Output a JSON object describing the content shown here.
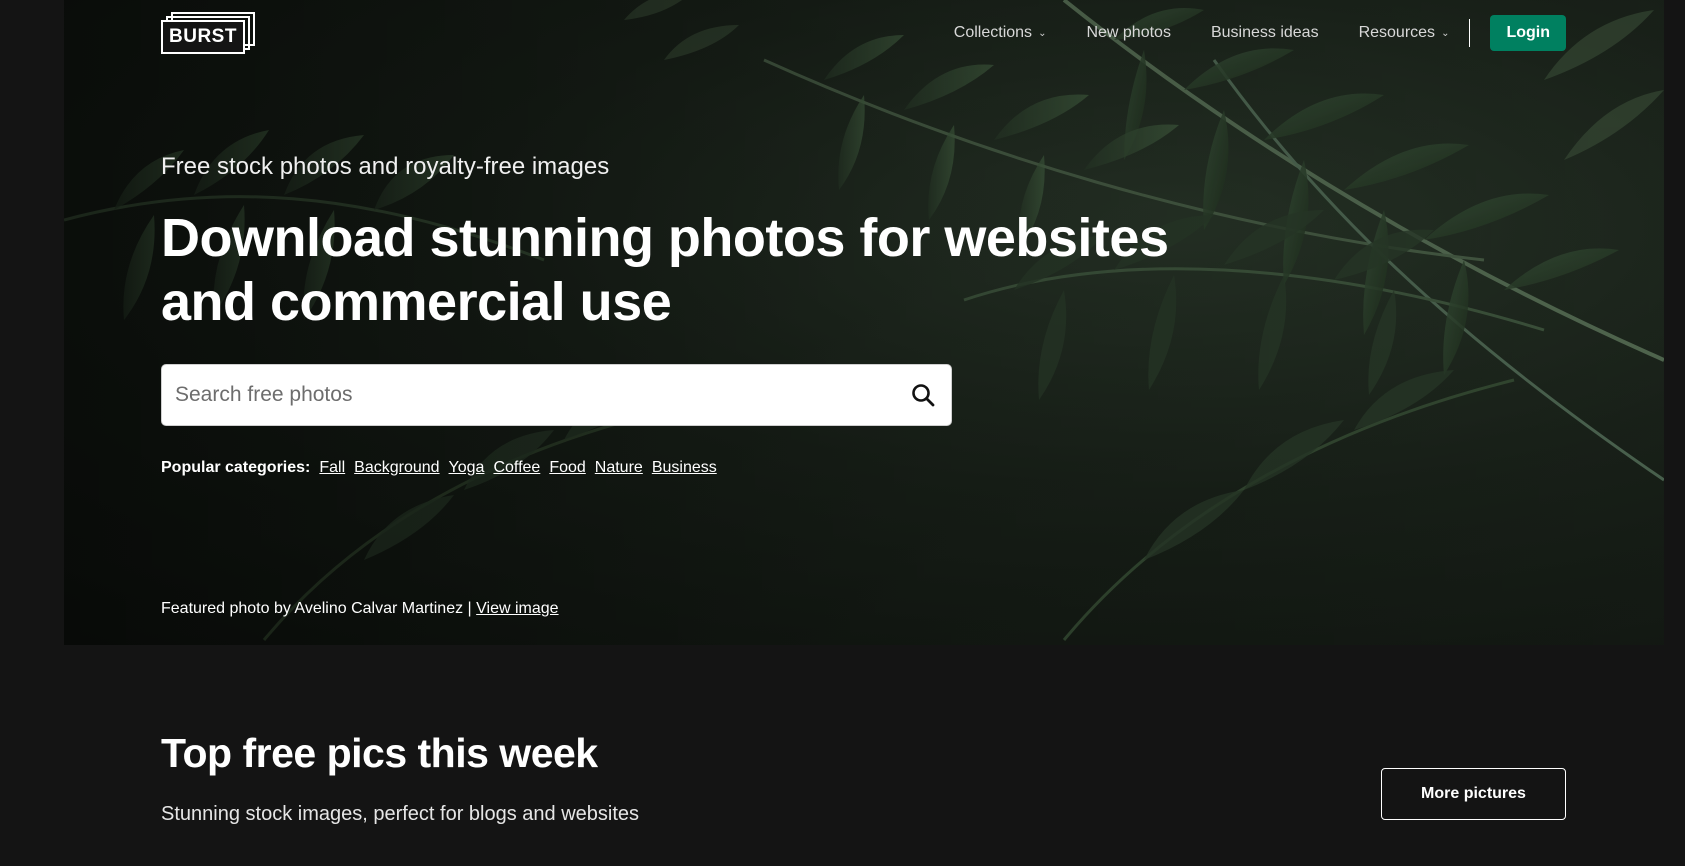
{
  "logo": {
    "text": "BURST"
  },
  "nav": {
    "items": [
      {
        "label": "Collections",
        "has_dropdown": true
      },
      {
        "label": "New photos",
        "has_dropdown": false
      },
      {
        "label": "Business ideas",
        "has_dropdown": false
      },
      {
        "label": "Resources",
        "has_dropdown": true
      }
    ],
    "login_label": "Login"
  },
  "hero": {
    "subtitle": "Free stock photos and royalty-free images",
    "title": "Download stunning photos for websites and commercial use",
    "search": {
      "placeholder": "Search free photos",
      "value": "",
      "icon": "search-icon"
    },
    "popular_label": "Popular categories:",
    "categories": [
      "Fall",
      "Background",
      "Yoga",
      "Coffee",
      "Food",
      "Nature",
      "Business"
    ],
    "credit_text": "Featured photo by Avelino Calvar Martinez |",
    "credit_link": "View image"
  },
  "section": {
    "title": "Top free pics this week",
    "subtitle": "Stunning stock images, perfect for blogs and websites",
    "more_label": "More pictures"
  },
  "colors": {
    "background": "#141414",
    "login_button": "#008060",
    "text": "#ffffff"
  }
}
